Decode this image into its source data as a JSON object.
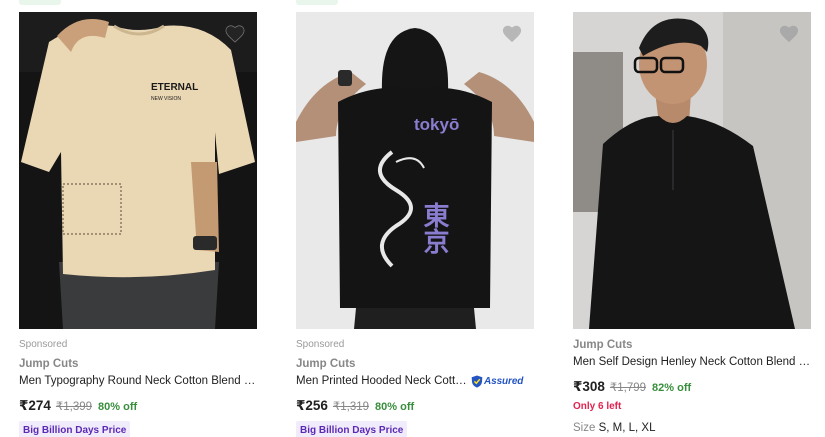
{
  "colors": {
    "price": "#212121",
    "mrp": "#878787",
    "discount": "#388e3c",
    "badge_bg": "#f1ecfb",
    "badge_text": "#5b2ab5",
    "stock": "#e0224f",
    "assured": "#2455c3"
  },
  "products": [
    {
      "sponsored": "Sponsored",
      "brand": "Jump Cuts",
      "title": "Men Typography Round Neck Cotton Blend B...",
      "price": "₹274",
      "mrp": "₹1,399",
      "discount": "80% off",
      "badge": "Big Billion Days Price",
      "image_print": "ETERNAL",
      "image_print_sub": "NEW VISION",
      "icon": "heart-icon"
    },
    {
      "sponsored": "Sponsored",
      "brand": "Jump Cuts",
      "title": "Men Printed Hooded Neck Cotto...",
      "assured": "Assured",
      "price": "₹256",
      "mrp": "₹1,319",
      "discount": "80% off",
      "badge": "Big Billion Days Price",
      "image_print": "tokyō",
      "image_print_sub": "東京",
      "icon": "heart-icon"
    },
    {
      "brand": "Jump Cuts",
      "title": "Men Self Design Henley Neck Cotton Blend B...",
      "price": "₹308",
      "mrp": "₹1,799",
      "discount": "82% off",
      "stock": "Only 6 left",
      "sizes_label": "Size",
      "sizes": "S, M, L, XL",
      "icon": "heart-icon"
    }
  ]
}
